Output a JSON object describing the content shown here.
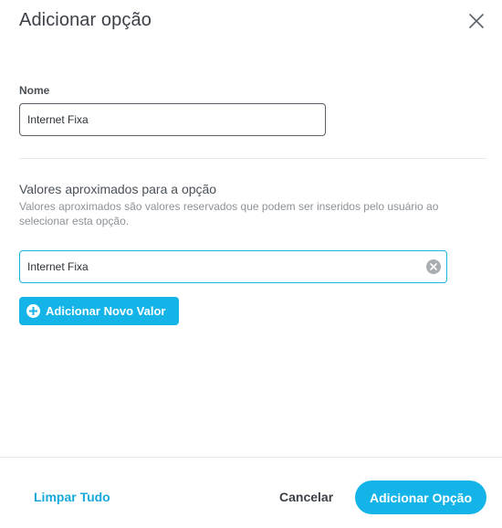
{
  "dialog": {
    "title": "Adicionar opção",
    "close_icon": "close-icon"
  },
  "name_field": {
    "label": "Nome",
    "value": "Internet Fixa"
  },
  "approx_values": {
    "title": "Valores aproximados para a opção",
    "description": "Valores aproximados são valores reservados que podem ser inseridos pelo usuário ao selecionar esta opção.",
    "values": [
      "Internet Fixa"
    ],
    "clear_icon": "clear-circle-icon",
    "add_button_label": "Adicionar Novo Valor",
    "add_icon": "plus-circle-icon"
  },
  "footer": {
    "clear_all_label": "Limpar Tudo",
    "cancel_label": "Cancelar",
    "submit_label": "Adicionar Opção"
  },
  "colors": {
    "accent": "#14b4e8",
    "link": "#18a9dc",
    "focus_border": "#1fb4e2",
    "text_dark": "#3c4147",
    "text_muted": "#8d9298"
  }
}
